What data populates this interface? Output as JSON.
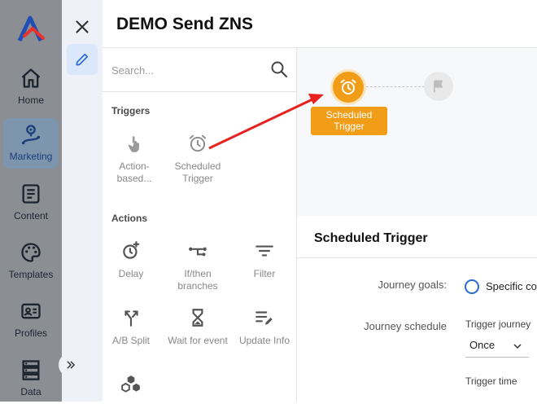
{
  "app": {
    "title": "DEMO Send ZNS"
  },
  "nav": {
    "items": [
      {
        "label": "Home",
        "icon": "home-icon"
      },
      {
        "label": "Marketing",
        "icon": "marketing-icon",
        "active": true
      },
      {
        "label": "Content",
        "icon": "content-icon"
      },
      {
        "label": "Templates",
        "icon": "palette-icon"
      },
      {
        "label": "Profiles",
        "icon": "profile-card-icon"
      },
      {
        "label": "Data",
        "icon": "database-icon"
      }
    ]
  },
  "palette": {
    "search_placeholder": "Search...",
    "triggers_heading": "Triggers",
    "triggers": [
      {
        "label": "Action-based...",
        "icon": "hand-pointer-icon"
      },
      {
        "label": "Scheduled Trigger",
        "icon": "alarm-clock-icon"
      }
    ],
    "actions_heading": "Actions",
    "actions": [
      {
        "label": "Delay",
        "icon": "timer-plus-icon"
      },
      {
        "label": "If/then branches",
        "icon": "branch-icon"
      },
      {
        "label": "Filter",
        "icon": "filter-icon"
      },
      {
        "label": "A/B Split",
        "icon": "split-icon"
      },
      {
        "label": "Wait for event",
        "icon": "hourglass-icon"
      },
      {
        "label": "Update Info",
        "icon": "edit-list-icon"
      }
    ]
  },
  "canvas": {
    "node_label": "Scheduled Trigger"
  },
  "details": {
    "title": "Scheduled Trigger",
    "journey_goals_label": "Journey goals:",
    "journey_goals_option": "Specific co",
    "journey_schedule_label": "Journey schedule",
    "trigger_journey_label": "Trigger journey",
    "trigger_journey_value": "Once",
    "trigger_time_label": "Trigger time"
  },
  "colors": {
    "accent_orange": "#f29d17",
    "brand_blue": "#2a6bd1",
    "nav_bg": "#8b8f94",
    "arrow_red": "#e8211f"
  }
}
